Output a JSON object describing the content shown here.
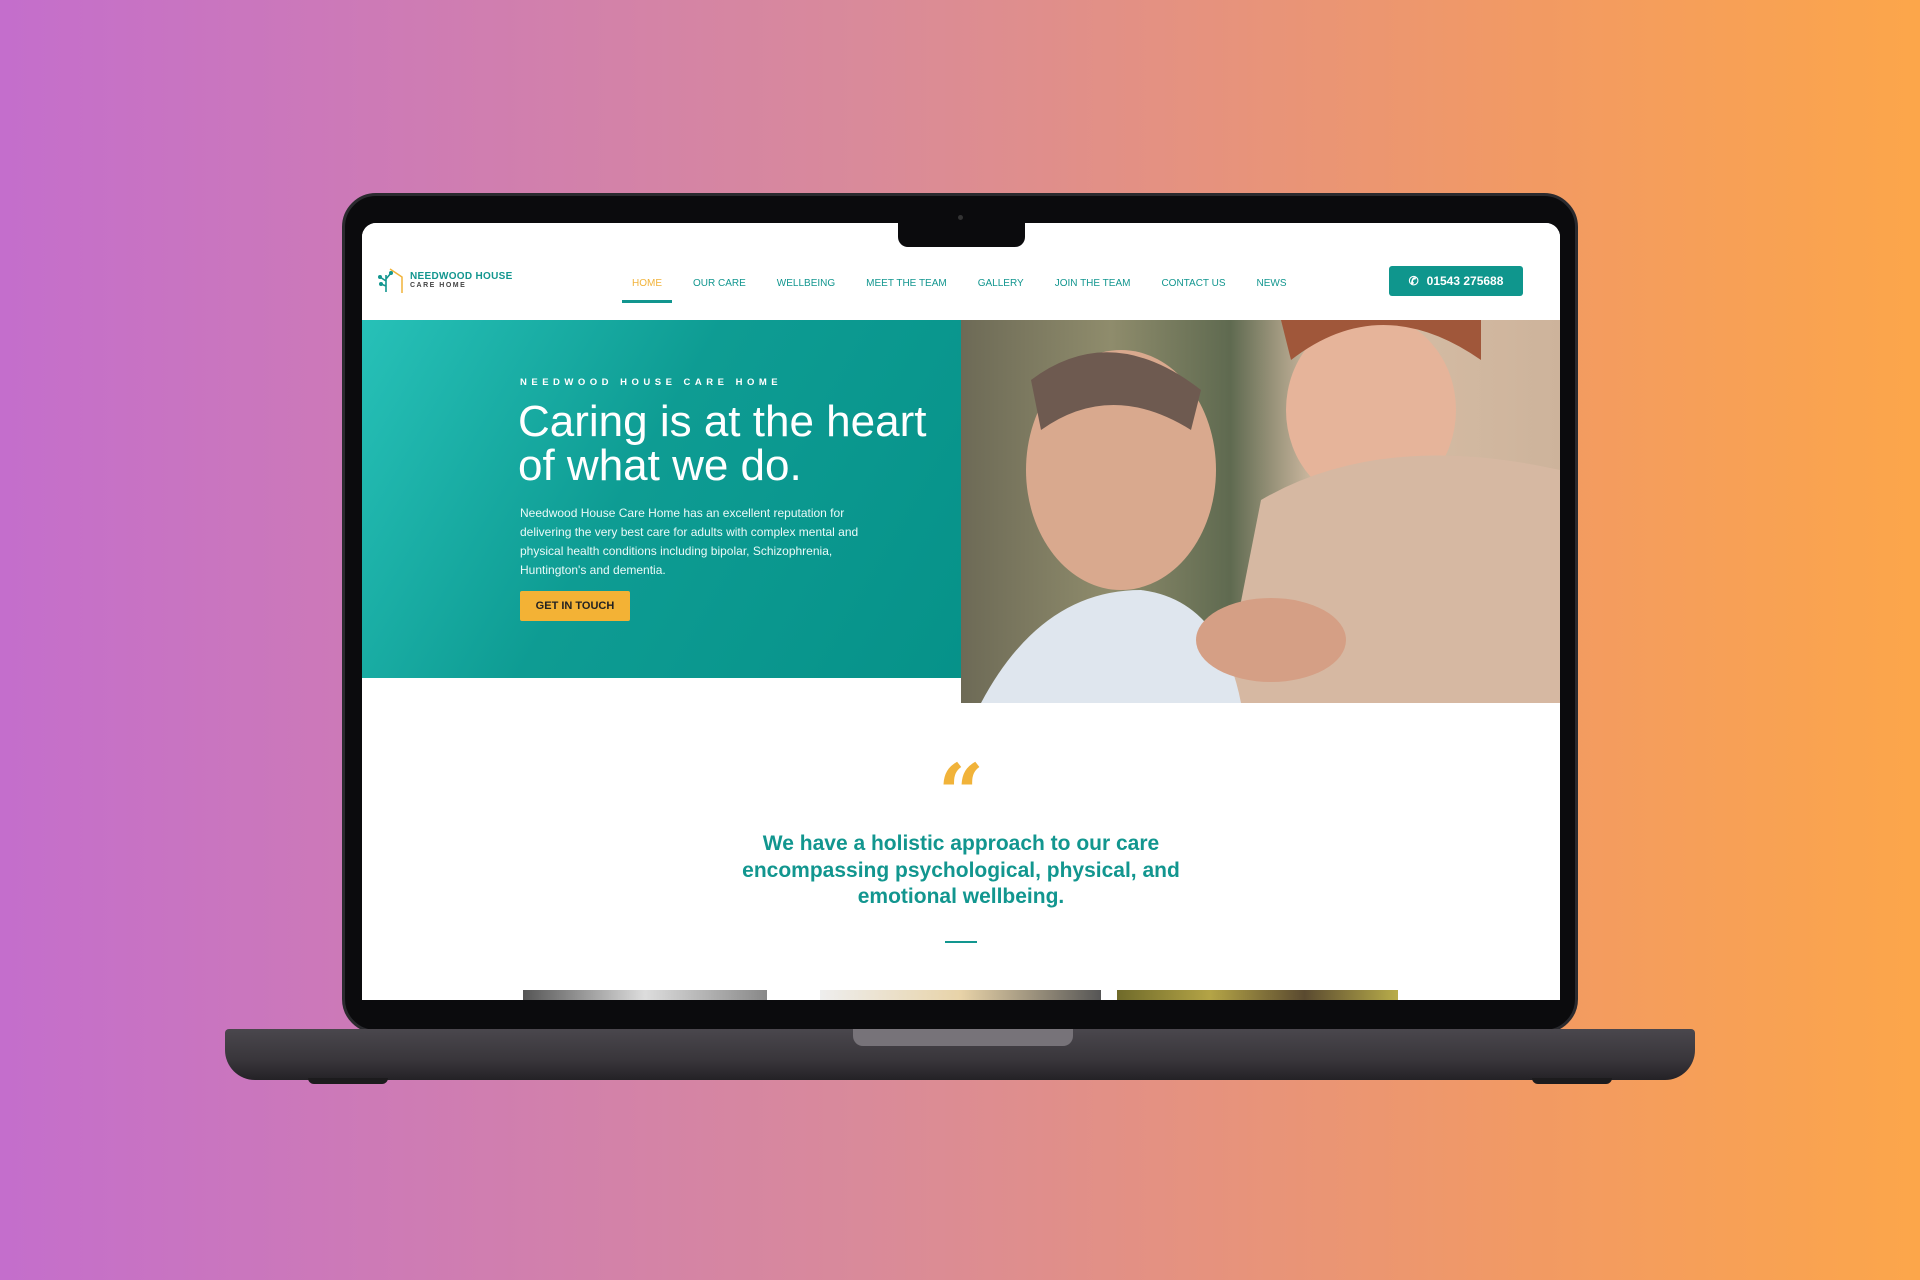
{
  "brand": {
    "name": "NEEDWOOD HOUSE",
    "sub": "CARE HOME"
  },
  "nav": [
    {
      "label": "HOME",
      "active": true
    },
    {
      "label": "OUR CARE"
    },
    {
      "label": "WELLBEING"
    },
    {
      "label": "MEET THE TEAM"
    },
    {
      "label": "GALLERY"
    },
    {
      "label": "JOIN THE TEAM"
    },
    {
      "label": "CONTACT US"
    },
    {
      "label": "NEWS"
    }
  ],
  "phone": {
    "icon": "phone-icon",
    "label": "01543 275688"
  },
  "hero": {
    "eyebrow": "NEEDWOOD HOUSE CARE HOME",
    "title": "Caring is at the heart of what we do.",
    "body": "Needwood House Care Home has an excellent reputation for delivering the very best care for adults with complex mental and physical health conditions including bipolar, Schizophrenia, Huntington's and dementia.",
    "cta": "GET IN TOUCH"
  },
  "quote": {
    "icon": "quote-icon",
    "text": "We have a holistic approach to our care encompassing psychological, physical, and emotional wellbeing."
  },
  "colors": {
    "teal": "#12968f",
    "accent": "#f1b33a"
  }
}
